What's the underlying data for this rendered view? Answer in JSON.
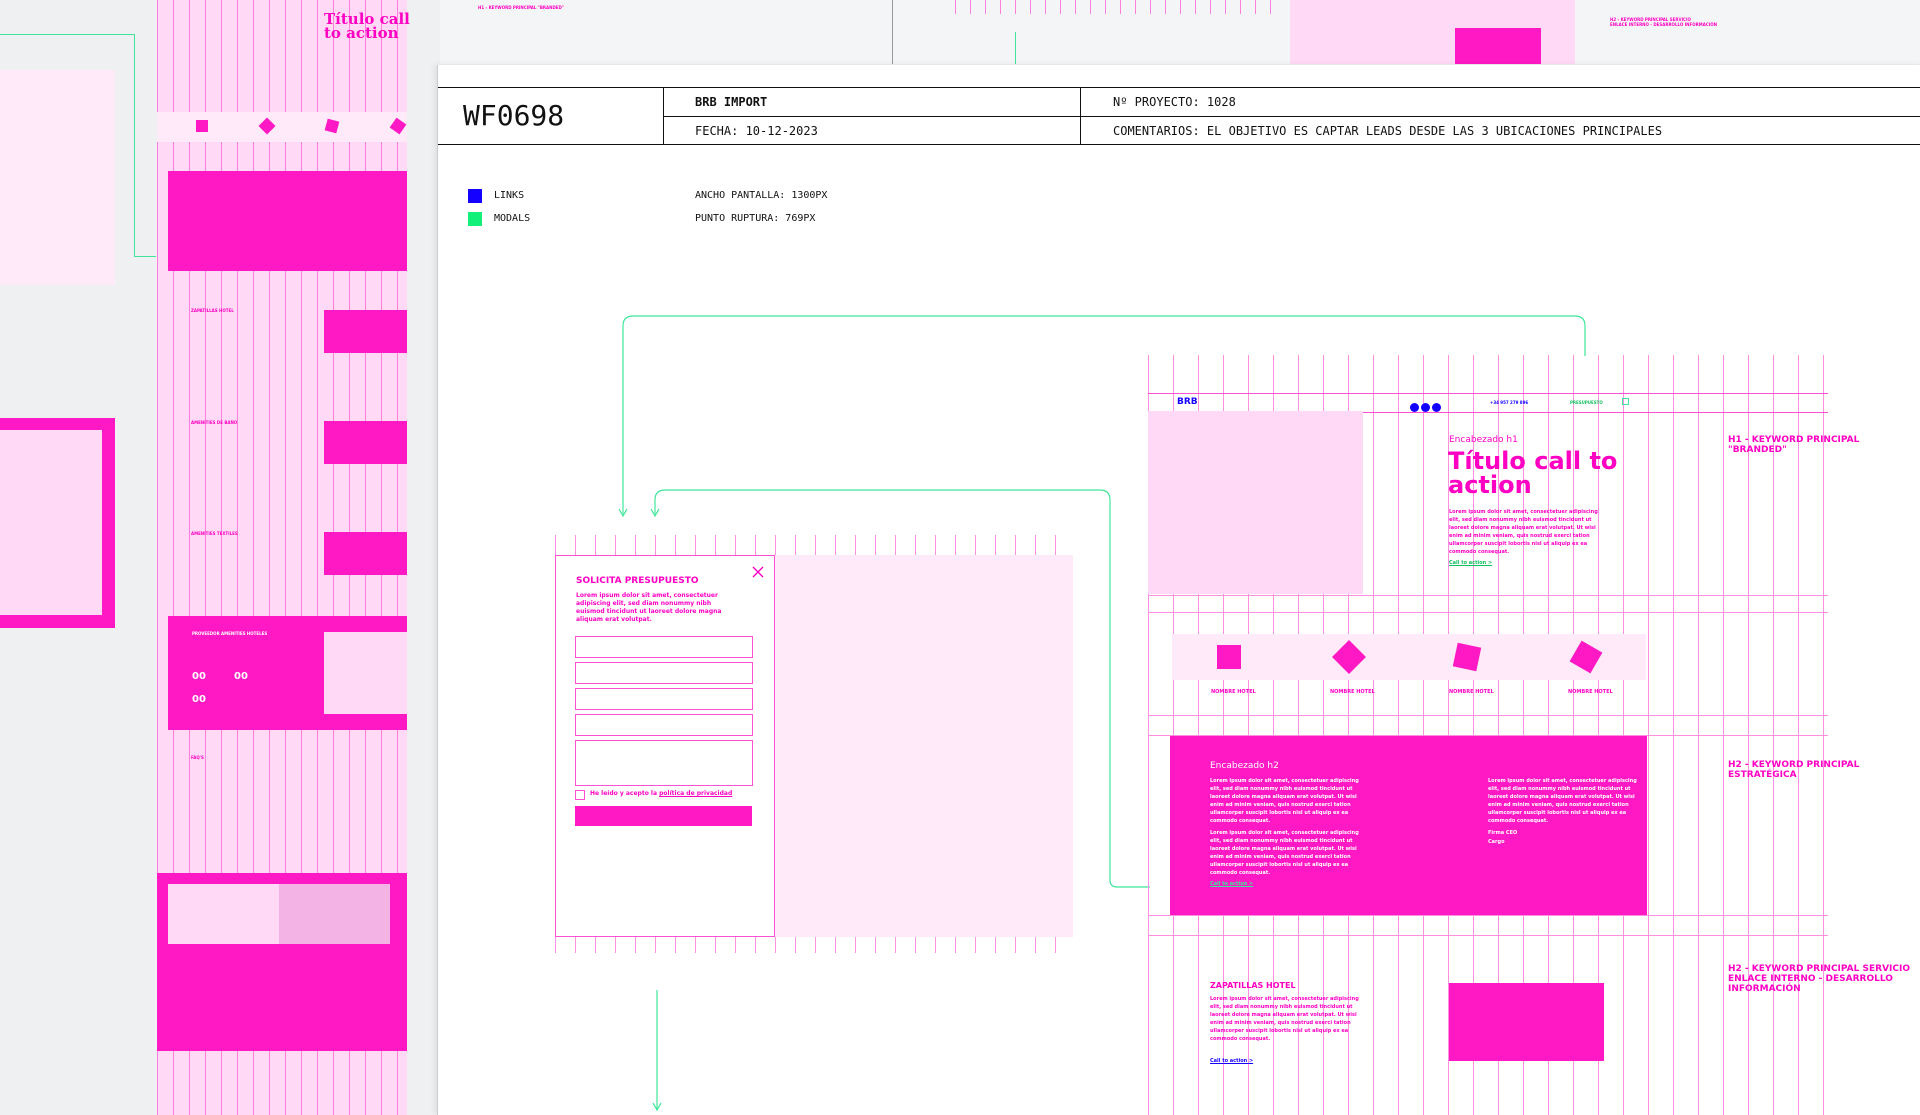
{
  "header": {
    "code": "WF0698",
    "client": "BRB IMPORT",
    "project": "Nº PROYECTO: 1028",
    "date": "FECHA: 10-12-2023",
    "comments": "COMENTARIOS: EL OBJETIVO ES CAPTAR LEADS DESDE LAS 3 UBICACIONES PRINCIPALES"
  },
  "legend": {
    "links": "LINKS",
    "modals": "MODALS",
    "links_color": "#1400ff",
    "modals_color": "#12f07a",
    "screen_width": "ANCHO PANTALLA: 1300PX",
    "breakpoint": "PUNTO RUPTURA: 769PX"
  },
  "modal": {
    "title": "SOLICITA PRESUPUESTO",
    "text": "Lorem ipsum dolor sit amet, consectetuer adipiscing elit, sed diam nonummy nibh euismod tincidunt ut laoreet dolore magna aliquam erat volutpat.",
    "privacy_prefix": "He leído y acepto la ",
    "privacy_link": "política de privacidad",
    "close_icon": "close-icon"
  },
  "wireframe": {
    "logo": "BRB",
    "phone": "+34 957 279 896",
    "cta_nav": "PRESUPUESTO",
    "h1_label": "Encabezado h1",
    "h1_title": "Título call to action",
    "h1_text": "Lorem ipsum dolor sit amet, consectetuer adipiscing elit, sed diam nonummy nibh euismod tincidunt ut laoreet dolore magna aliquam erat volutpat. Ut wisi enim ad minim veniam, quis nostrud exerci tation ullamcorper suscipit lobortis nisl ut aliquip ex ea commodo consequat.",
    "cta": "Call to action >",
    "hotels": [
      "NOMBRE HOTEL",
      "NOMBRE HOTEL",
      "NOMBRE HOTEL",
      "NOMBRE HOTEL"
    ],
    "h2_label": "Encabezado h2",
    "h2_text_a": "Lorem ipsum dolor sit amet, consectetuer adipiscing elit, sed diam nonummy nibh euismod tincidunt ut laoreet dolore magna aliquam erat volutpat. Ut wisi enim ad minim veniam, quis nostrud exerci tation ullamcorper suscipit lobortis nisl ut aliquip ex ea commodo consequat.",
    "h2_text_b": "Lorem ipsum dolor sit amet, consectetuer adipiscing elit, sed diam nonummy nibh euismod tincidunt ut laoreet dolore magna aliquam erat volutpat. Ut wisi enim ad minim veniam, quis nostrud exerci tation ullamcorper suscipit lobortis nisl ut aliquip ex ea commodo consequat.",
    "h2_text_c": "Lorem ipsum dolor sit amet, consectetuer adipiscing elit, sed diam nonummy nibh euismod tincidunt ut laoreet dolore magna aliquam erat volutpat. Ut wisi enim ad minim veniam, quis nostrud exerci tation ullamcorper suscipit lobortis nisl ut aliquip ex ea commodo consequat.",
    "signature": "Firma CEO",
    "position": "Cargo",
    "section3_title": "ZAPATILLAS HOTEL",
    "section3_text": "Lorem ipsum dolor sit amet, consectetuer adipiscing elit, sed diam nonummy nibh euismod tincidunt ut laoreet dolore magna aliquam erat volutpat. Ut wisi enim ad minim veniam, quis nostrud exerci tation ullamcorper suscipit lobortis nisl ut aliquip ex ea commodo consequat.",
    "section3_cta": "Call to action >"
  },
  "notes": {
    "h1": "H1 - KEYWORD PRINCIPAL \"BRANDED\"",
    "h2": "H2 - KEYWORD PRINCIPAL ESTRATÉGICA",
    "h2_service_1": "H2 - KEYWORD PRINCIPAL SERVICIO",
    "h2_service_2": "ENLACE INTERNO - DESARROLLO INFORMACIÓN"
  },
  "background_wireframe": {
    "title": "Título call to action",
    "sections": [
      "ZAPATILLAS HOTEL",
      "AMENITIES DE BAÑO",
      "AMENITIES TEXTILES",
      "PROVEEDOR AMENITIES HOTELES",
      "FAQ'S"
    ],
    "counter": "00",
    "top_note_1": "H1 - KEYWORD PRINCIPAL \"BRANDED\"",
    "top_note_2": "H2 - KEYWORD PRINCIPAL SERVICIO",
    "top_note_3": "ENLACE INTERNO - DESARROLLO INFORMACIÓN"
  }
}
